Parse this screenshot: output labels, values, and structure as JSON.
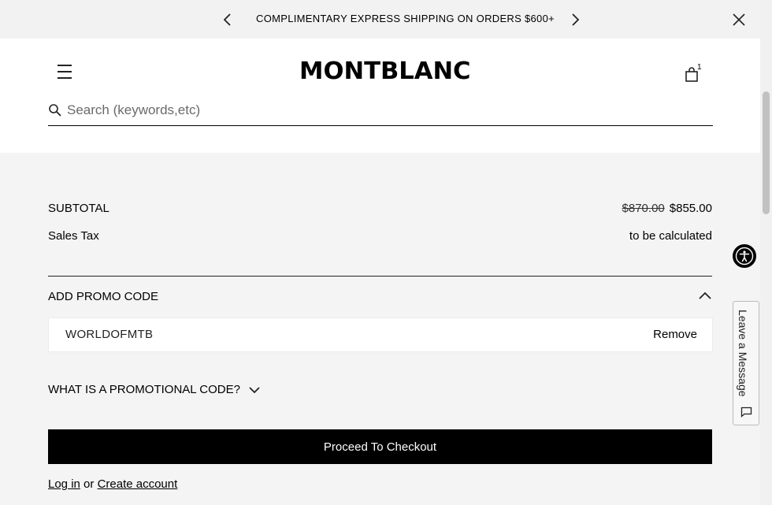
{
  "banner": {
    "message": "COMPLIMENTARY EXPRESS SHIPPING ON ORDERS $600+"
  },
  "header": {
    "logo": "MONTBLANC",
    "cart_count": "1"
  },
  "search": {
    "placeholder": "Search (keywords,etc)"
  },
  "summary": {
    "subtotal_label": "SUBTOTAL",
    "subtotal_original": "$870.00",
    "subtotal_value": "$855.00",
    "tax_label": "Sales Tax",
    "tax_value": "to be calculated"
  },
  "promo": {
    "title": "ADD PROMO CODE",
    "code": "WORLDOFMTB",
    "remove_label": "Remove",
    "what_is_label": "WHAT IS A PROMOTIONAL CODE?"
  },
  "checkout": {
    "button_label": "Proceed To Checkout"
  },
  "account": {
    "login_label": "Log in",
    "or_text": "or",
    "create_label": "Create account"
  },
  "widgets": {
    "leave_message": "Leave a Message"
  },
  "icons": [
    "chevron-left-icon",
    "chevron-right-icon",
    "close-icon",
    "hamburger-menu-icon",
    "shopping-bag-icon",
    "search-icon",
    "chevron-up-icon",
    "chevron-down-icon",
    "accessibility-icon",
    "chat-bubble-icon"
  ]
}
